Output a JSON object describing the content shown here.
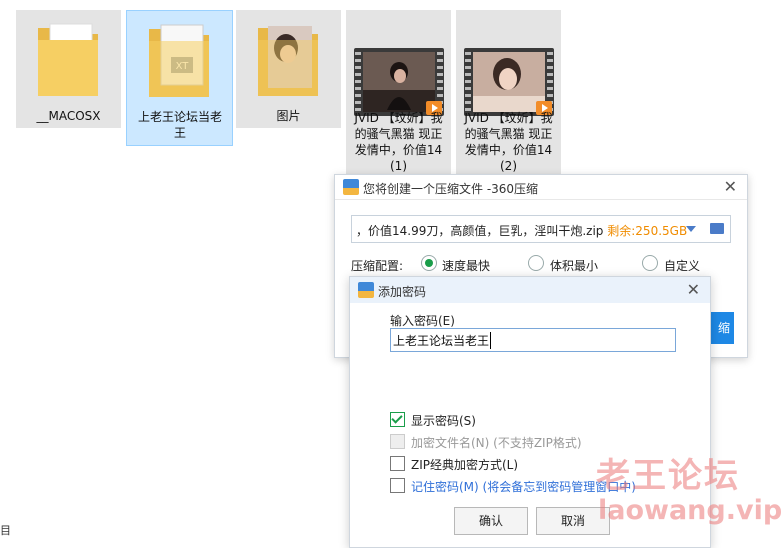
{
  "files": [
    {
      "label": "__MACOSX",
      "kind": "folder"
    },
    {
      "label": "上老王论坛当老王",
      "kind": "folder-txt",
      "selected": true
    },
    {
      "label": "图片",
      "kind": "folder-photo"
    },
    {
      "label": "JVID 【玟妡】我的骚气黑猫 现正发情中，价值14 (1)",
      "kind": "video"
    },
    {
      "label": "JVID 【玟妡】我的骚气黑猫 现正发情中，价值14 (2)",
      "kind": "video"
    }
  ],
  "compress_dialog": {
    "title": "您将创建一个压缩文件 -360压缩",
    "path": "，价值14.99刀，高颜值，巨乳，淫叫干炮.zip",
    "free_space": "剩余:250.5GB",
    "config_label": "压缩配置:",
    "options": [
      "速度最快",
      "体积最小",
      "自定义"
    ],
    "selected_option": "速度最快",
    "button_partial": "缩"
  },
  "password_dialog": {
    "title": "添加密码",
    "input_label": "输入密码(E)",
    "input_value": "上老王论坛当老王",
    "show_password": "显示密码(S)",
    "encrypt_names": "加密文件名(N) (不支持ZIP格式)",
    "zip_classic": "ZIP经典加密方式(L)",
    "remember": "记住密码(M) (将会备忘到密码管理窗口中)",
    "ok": "确认",
    "cancel": "取消"
  },
  "watermark": {
    "line1": "老王论坛",
    "line2": "laowang.vip"
  },
  "edge_text": "目",
  "colors": {
    "selection": "#cce8ff",
    "accent_green": "#1a9d4a",
    "accent_blue": "#1e88e5",
    "free_space": "#f08c00"
  }
}
